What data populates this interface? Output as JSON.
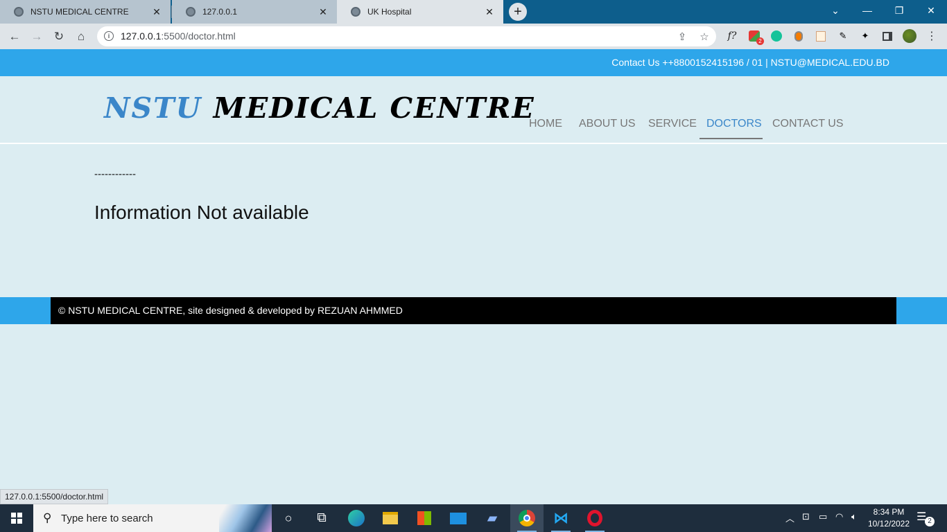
{
  "browser": {
    "tabs": [
      {
        "title": "NSTU MEDICAL CENTRE",
        "active": false
      },
      {
        "title": "127.0.0.1",
        "active": false
      },
      {
        "title": "UK Hospital",
        "active": true
      }
    ],
    "address": {
      "host": "127.0.0.1",
      "rest": ":5500/doctor.html"
    },
    "status_url": "127.0.0.1:5500/doctor.html",
    "extensions": {
      "formula": "f?",
      "badge_count": "2"
    }
  },
  "site": {
    "contact_line": "Contact Us ++8800152415196 / 01 | NSTU@MEDICAL.EDU.BD",
    "logo": {
      "part1": "NSTU",
      "part2": "MEDICAL CENTRE"
    },
    "nav": [
      {
        "label": "HOME"
      },
      {
        "label": "ABOUT US"
      },
      {
        "label": "SERVICE"
      },
      {
        "label": "DOCTORS"
      },
      {
        "label": "CONTACT US"
      }
    ],
    "divider_text": "------------",
    "message": "Information Not available",
    "footer": "© NSTU MEDICAL CENTRE, site designed & developed by REZUAN AHMMED"
  },
  "taskbar": {
    "search_placeholder": "Type here to search",
    "time": "8:34 PM",
    "date": "10/12/2022",
    "notification_count": "2"
  },
  "colors": {
    "accent_blue": "#2ea6ea",
    "logo_blue": "#3a86c9",
    "page_bg": "#dcedf2",
    "footer_bg": "#000000"
  }
}
